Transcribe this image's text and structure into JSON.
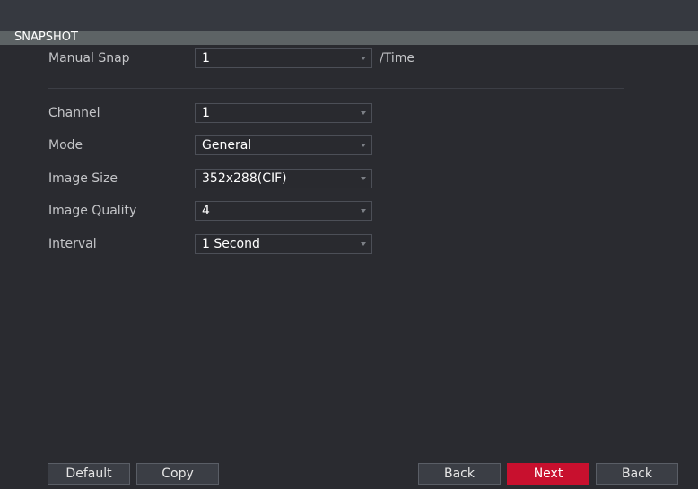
{
  "section": {
    "title": "SNAPSHOT"
  },
  "manual_snap": {
    "label": "Manual Snap",
    "value": "1",
    "unit": "/Time"
  },
  "fields": {
    "channel": {
      "label": "Channel",
      "value": "1"
    },
    "mode": {
      "label": "Mode",
      "value": "General"
    },
    "image_size": {
      "label": "Image Size",
      "value": "352x288(CIF)"
    },
    "image_quality": {
      "label": "Image Quality",
      "value": "4"
    },
    "interval": {
      "label": "Interval",
      "value": "1 Second"
    }
  },
  "buttons": {
    "default": "Default",
    "copy": "Copy",
    "back1": "Back",
    "next": "Next",
    "back2": "Back"
  },
  "colors": {
    "background": "#2a2b30",
    "header_bar": "#5d6365",
    "primary_button": "#c8102e"
  },
  "icons": {
    "dropdown": "chevron-down-icon"
  }
}
